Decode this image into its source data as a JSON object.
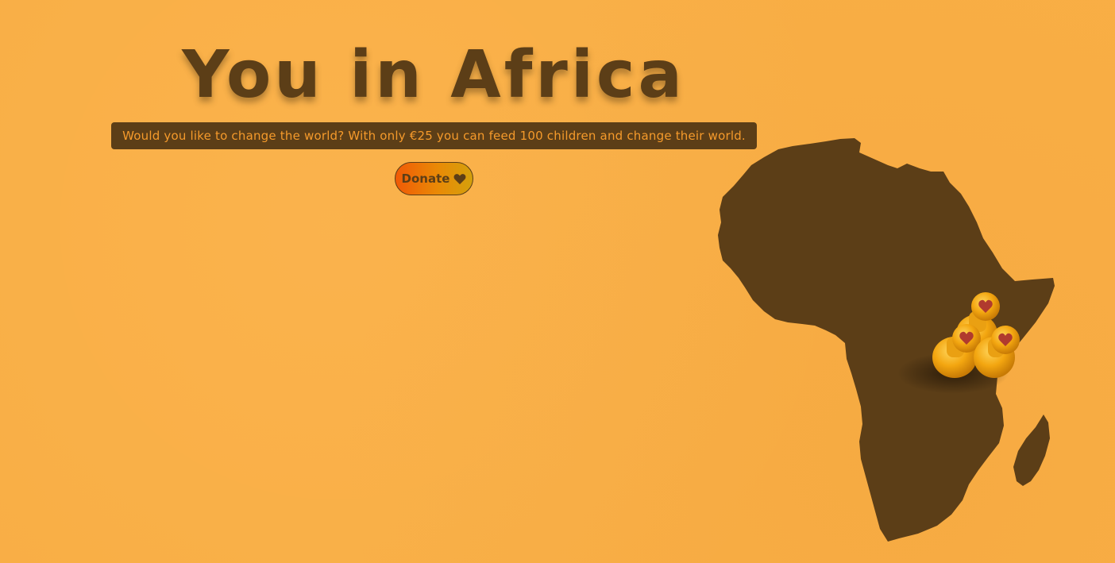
{
  "hero": {
    "title": "You in Africa",
    "tagline": "Would you like to change the world? With only €25 you can feed 100 children and change their world."
  },
  "donate": {
    "label": "Donate",
    "icon": "heart-icon"
  },
  "map": {
    "region": "Africa",
    "pin_icon": "heart-pin-icon",
    "pin_count": 3
  },
  "colors": {
    "background": "#f9ae45",
    "brown": "#5c3e17",
    "tagline_text": "#f59a2b",
    "button_gradient_start": "#f05a06",
    "button_gradient_end": "#d4a00c",
    "pin_yellow": "#f3a610",
    "heart_red": "#b03a2e"
  }
}
